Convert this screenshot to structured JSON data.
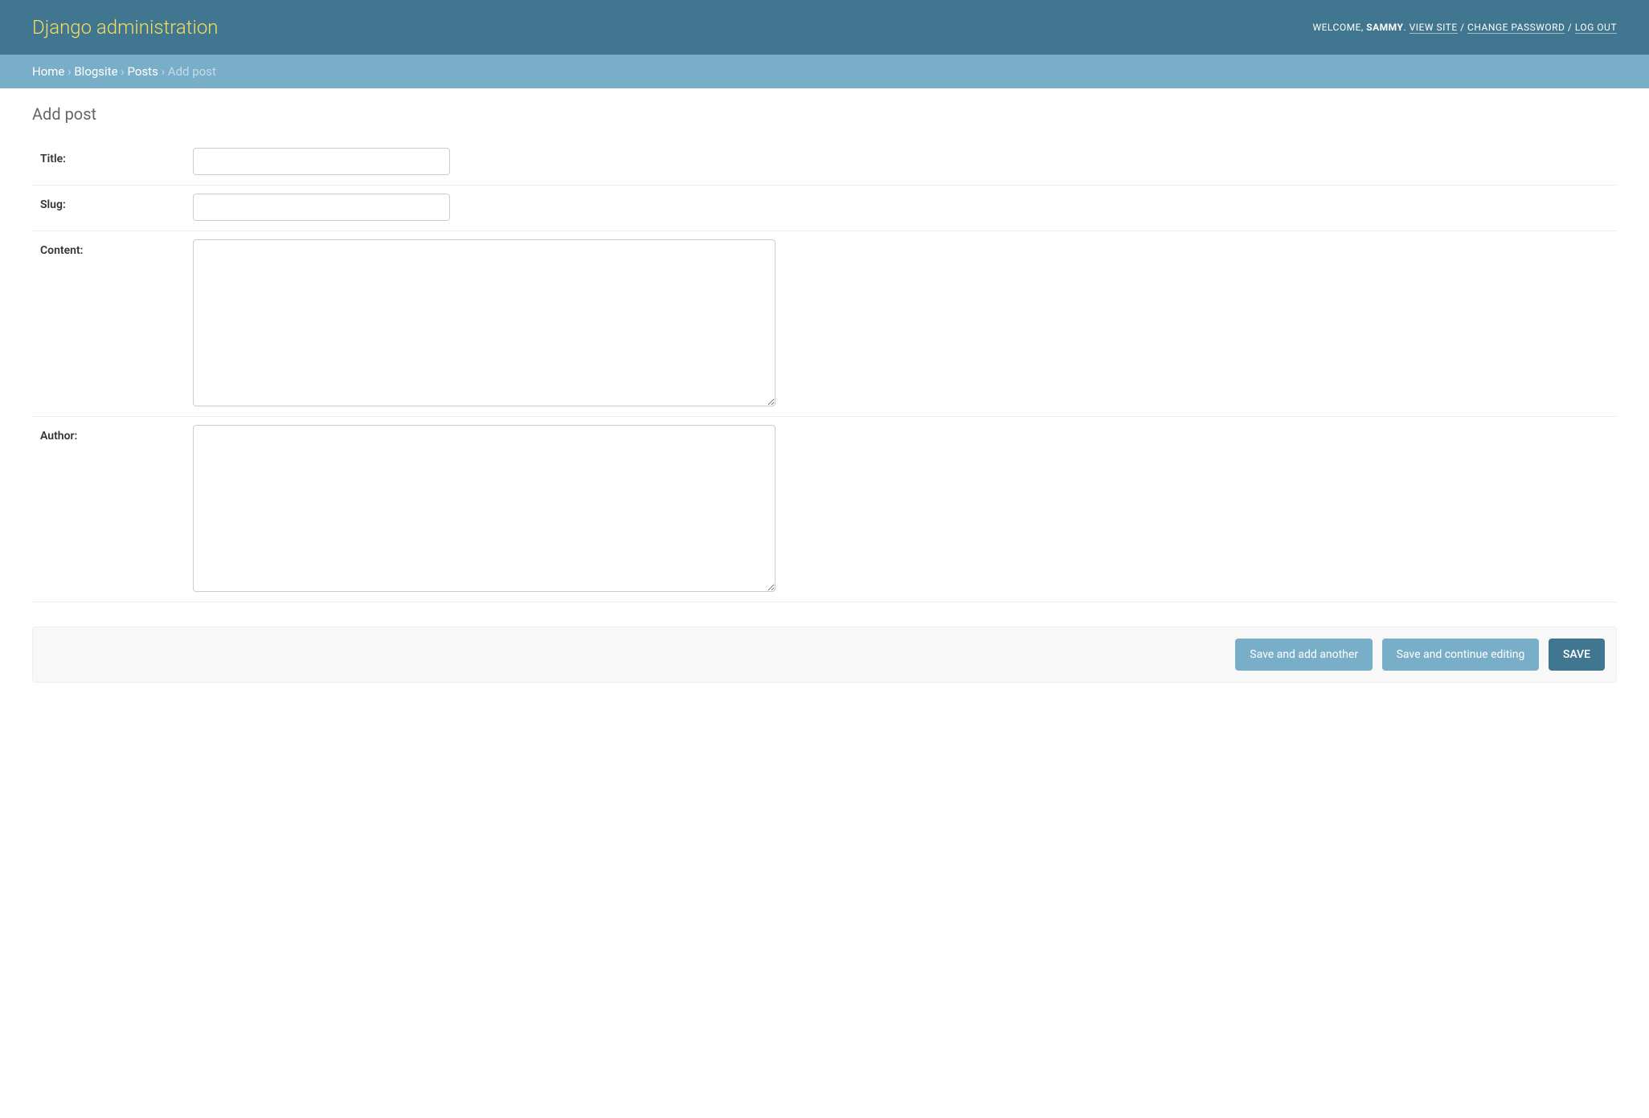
{
  "header": {
    "site_title": "Django administration",
    "welcome_label": "WELCOME, ",
    "username": "SAMMY",
    "view_site_label": "VIEW SITE",
    "change_password_label": "CHANGE PASSWORD",
    "log_out_label": "LOG OUT",
    "separator": " / ",
    "period": ". "
  },
  "breadcrumbs": {
    "home": "Home",
    "app": "Blogsite",
    "model": "Posts",
    "current": "Add post",
    "sep": " › "
  },
  "page": {
    "title": "Add post"
  },
  "form": {
    "title_label": "Title:",
    "title_value": "",
    "slug_label": "Slug:",
    "slug_value": "",
    "content_label": "Content:",
    "content_value": "",
    "author_label": "Author:",
    "author_value": ""
  },
  "buttons": {
    "save_add_another": "Save and add another",
    "save_continue": "Save and continue editing",
    "save": "SAVE"
  }
}
